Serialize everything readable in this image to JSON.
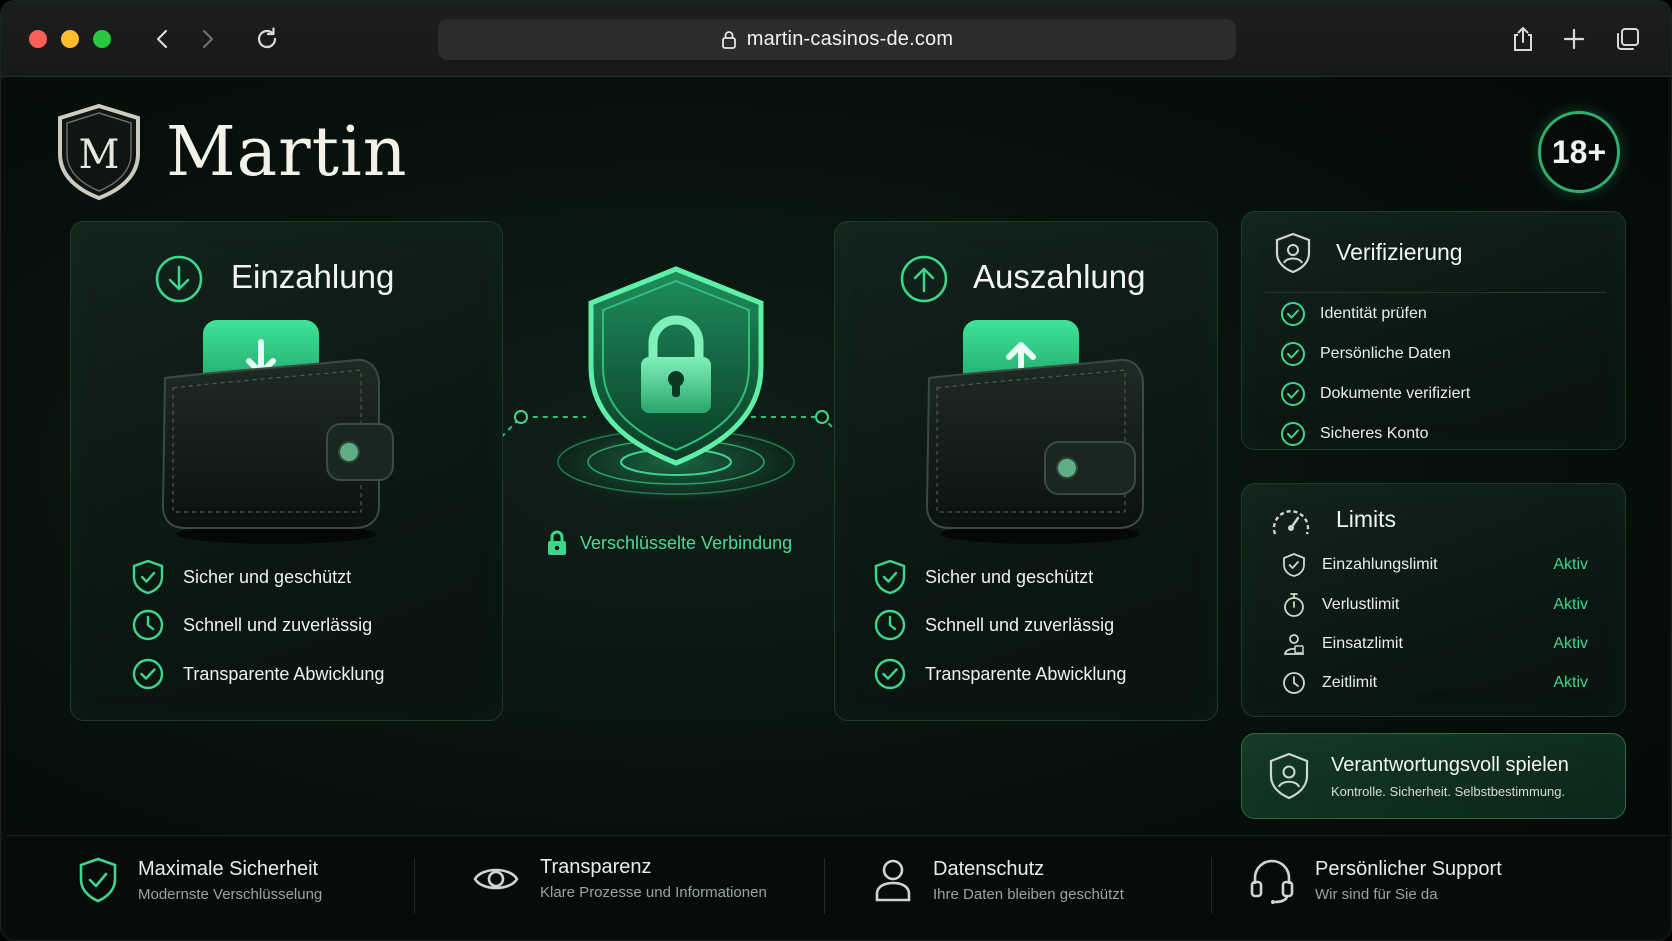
{
  "browser": {
    "url": "martin-casinos-de.com"
  },
  "brand": {
    "name": "Martin",
    "logo_letter": "M",
    "age_badge": "18+"
  },
  "deposit": {
    "title": "Einzahlung",
    "features": [
      "Sicher und geschützt",
      "Schnell und zuverlässig",
      "Transparente Abwicklung"
    ]
  },
  "withdrawal": {
    "title": "Auszahlung",
    "features": [
      "Sicher und geschützt",
      "Schnell und zuverlässig",
      "Transparente Abwicklung"
    ]
  },
  "security": {
    "label": "Verschlüsselte Verbindung"
  },
  "verification": {
    "title": "Verifizierung",
    "items": [
      "Identität prüfen",
      "Persönliche Daten",
      "Dokumente verifiziert",
      "Sicheres Konto"
    ]
  },
  "limits": {
    "title": "Limits",
    "items": [
      {
        "label": "Einzahlungslimit",
        "status": "Aktiv"
      },
      {
        "label": "Verlustlimit",
        "status": "Aktiv"
      },
      {
        "label": "Einsatzlimit",
        "status": "Aktiv"
      },
      {
        "label": "Zeitlimit",
        "status": "Aktiv"
      }
    ]
  },
  "responsible": {
    "title": "Verantwortungsvoll spielen",
    "subtitle": "Kontrolle. Sicherheit. Selbstbestimmung."
  },
  "footer": {
    "items": [
      {
        "title": "Maximale Sicherheit",
        "subtitle": "Modernste Verschlüsselung"
      },
      {
        "title": "Transparenz",
        "subtitle": "Klare Prozesse und Informationen"
      },
      {
        "title": "Datenschutz",
        "subtitle": "Ihre Daten bleiben geschützt"
      },
      {
        "title": "Persönlicher Support",
        "subtitle": "Wir sind für Sie da"
      }
    ]
  },
  "colors": {
    "accent": "#3dd68c",
    "accent_dark": "#1f7a4d",
    "card_bg": "#0e1d16",
    "background": "#07100c"
  }
}
